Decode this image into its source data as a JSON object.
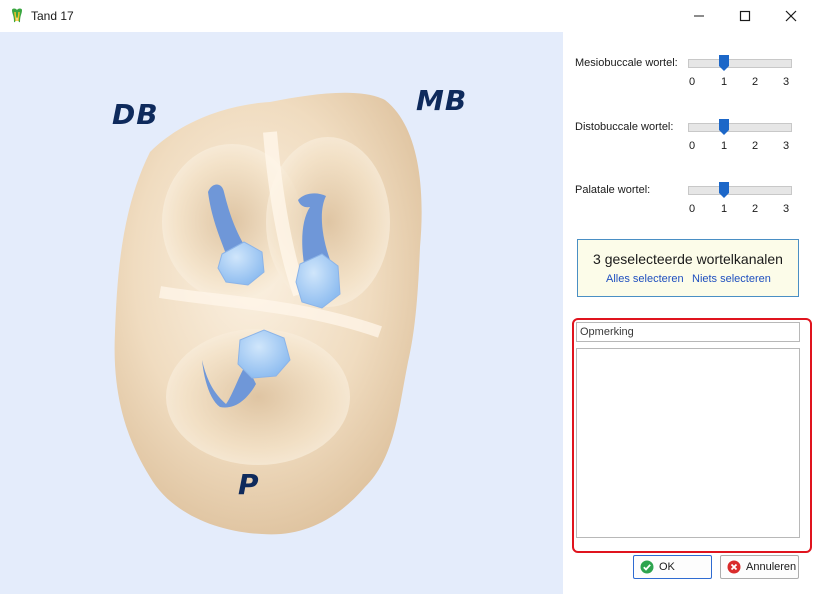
{
  "window": {
    "title": "Tand 17",
    "minimize_glyph": "—",
    "maximize_glyph": "☐",
    "close_glyph": "✕"
  },
  "viewport": {
    "labels": {
      "db": "DB",
      "mb": "MB",
      "p": "P"
    },
    "background": "#e4ecfb",
    "root_color": "#6f97d8",
    "tooth_color": "#efdcc0"
  },
  "sliders": [
    {
      "label": "Mesiobuccale wortel:",
      "value": 1,
      "min": 0,
      "max": 3,
      "ticks": [
        "0",
        "1",
        "2",
        "3"
      ]
    },
    {
      "label": "Distobuccale wortel:",
      "value": 1,
      "min": 0,
      "max": 3,
      "ticks": [
        "0",
        "1",
        "2",
        "3"
      ]
    },
    {
      "label": "Palatale wortel:",
      "value": 1,
      "min": 0,
      "max": 3,
      "ticks": [
        "0",
        "1",
        "2",
        "3"
      ]
    }
  ],
  "selection": {
    "count_text": "3 geselecteerde wortelkanalen",
    "select_all": "Alles selecteren",
    "select_none": "Niets selecteren"
  },
  "remark": {
    "label": "Opmerking",
    "value": ""
  },
  "buttons": {
    "ok": "OK",
    "cancel": "Annuleren"
  },
  "icons": {
    "app": "tooth-app-icon",
    "ok": "check-circle-icon",
    "cancel": "cancel-circle-icon"
  },
  "colors": {
    "accent_link": "#1f4fbf",
    "highlight": "#e0141e",
    "slider_thumb": "#1c67c8"
  }
}
